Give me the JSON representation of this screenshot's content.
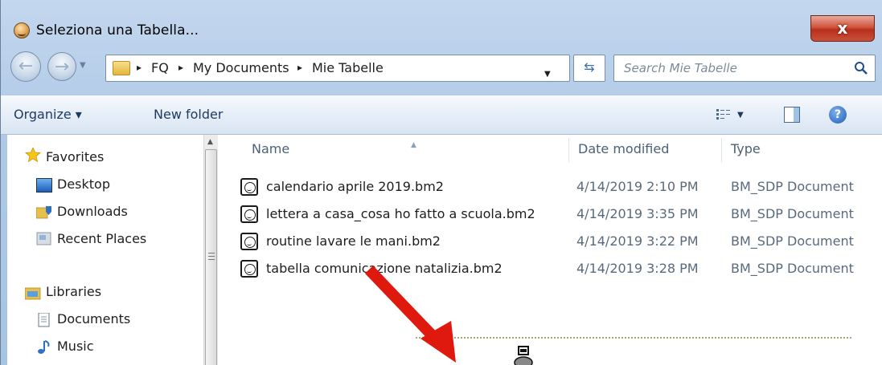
{
  "window": {
    "title": "Seleziona una Tabella...",
    "close_label": "x"
  },
  "address": {
    "crumbs": [
      "FQ",
      "My Documents",
      "Mie Tabelle"
    ],
    "separator": "▸"
  },
  "search": {
    "placeholder": "Search Mie Tabelle"
  },
  "toolbar": {
    "organize_label": "Organize ▾",
    "new_folder_label": "New folder",
    "help_label": "?"
  },
  "nav_pane": {
    "favorites_header": "Favorites",
    "favorites": [
      "Desktop",
      "Downloads",
      "Recent Places"
    ],
    "libraries_header": "Libraries",
    "libraries": [
      "Documents",
      "Music"
    ]
  },
  "file_list": {
    "columns": [
      "Name",
      "Date modified",
      "Type"
    ],
    "rows": [
      {
        "name": "calendario aprile 2019.bm2",
        "date": "4/14/2019 2:10 PM",
        "type": "BM_SDP Document"
      },
      {
        "name": "lettera a casa_cosa ho fatto a scuola.bm2",
        "date": "4/14/2019 3:35 PM",
        "type": "BM_SDP Document"
      },
      {
        "name": "routine lavare le mani.bm2",
        "date": "4/14/2019 3:22 PM",
        "type": "BM_SDP Document"
      },
      {
        "name": "tabella comunicazione natalizia.bm2",
        "date": "4/14/2019 3:28 PM",
        "type": "BM_SDP Document"
      }
    ]
  },
  "colors": {
    "overlay_arrow": "#e0190f",
    "chrome_blue": "#aec8e6"
  }
}
